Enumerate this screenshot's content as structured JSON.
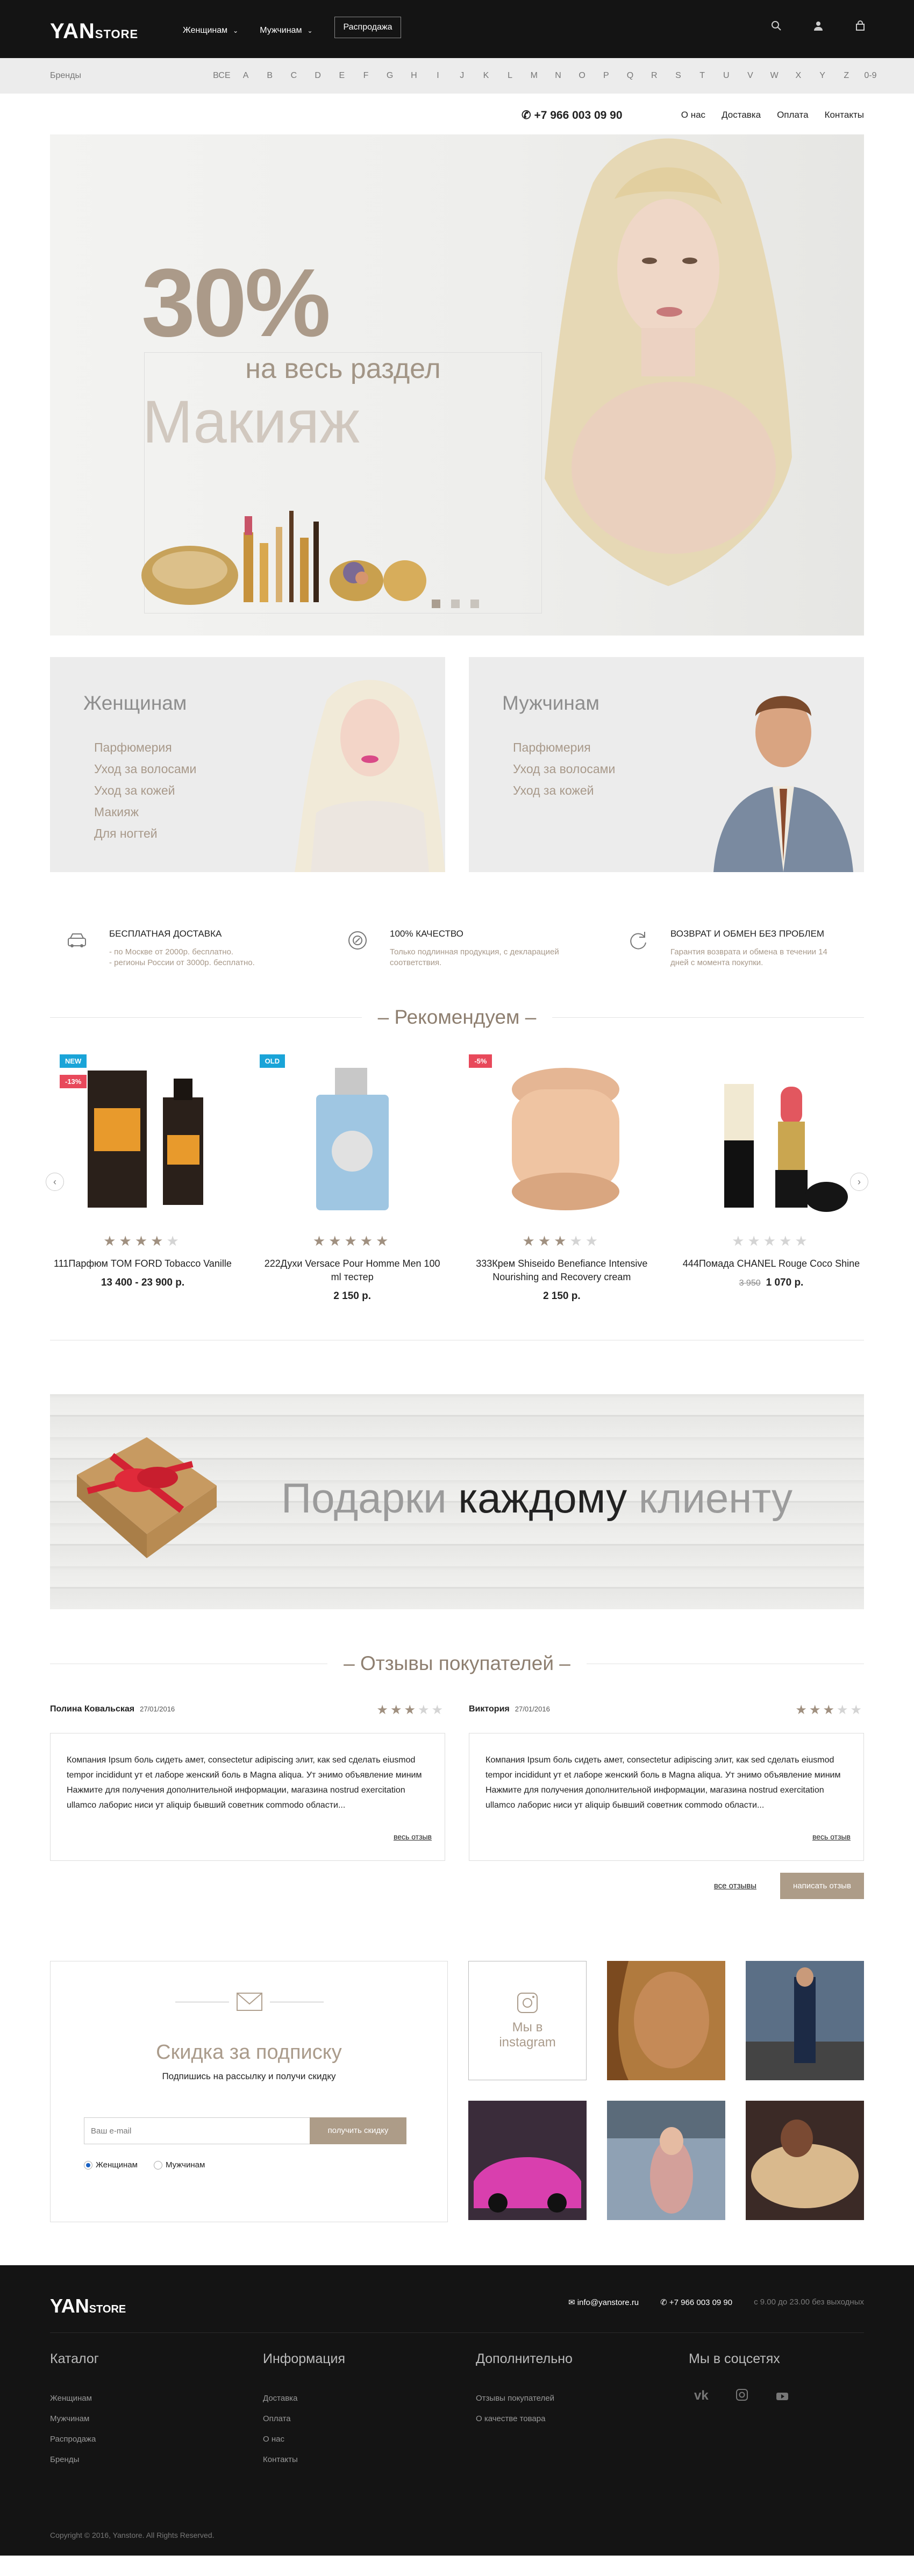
{
  "header": {
    "logo_main": "YAN",
    "logo_sub": "STORE",
    "nav": [
      {
        "label": "Женщинам"
      },
      {
        "label": "Мужчинам"
      }
    ],
    "sale": "Распродажа"
  },
  "brands": {
    "label": "Бренды",
    "letters": [
      "ВСЕ",
      "A",
      "B",
      "C",
      "D",
      "E",
      "F",
      "G",
      "H",
      "I",
      "J",
      "K",
      "L",
      "M",
      "N",
      "O",
      "P",
      "Q",
      "R",
      "S",
      "T",
      "U",
      "V",
      "W",
      "X",
      "Y",
      "Z",
      "0-9"
    ]
  },
  "utility": {
    "phone": "+7 966 003 09 90",
    "links": [
      "О нас",
      "Доставка",
      "Оплата",
      "Контакты"
    ]
  },
  "hero": {
    "percent": "30%",
    "subtitle": "на весь раздел",
    "category": "Макияж"
  },
  "categories": [
    {
      "title": "Женщинам",
      "items": [
        "Парфюмерия",
        "Уход за волосами",
        "Уход за кожей",
        "Макияж",
        "Для ногтей"
      ]
    },
    {
      "title": "Мужчинам",
      "items": [
        "Парфюмерия",
        "Уход за волосами",
        "Уход за кожей"
      ]
    }
  ],
  "features": [
    {
      "title": "БЕСПЛАТНАЯ ДОСТАВКА",
      "lines": [
        "- по Москве от 2000р. бесплатно.",
        "- регионы России от 3000р. бесплатно."
      ]
    },
    {
      "title": "100% КАЧЕСТВО",
      "lines": [
        "Только подлинная продукция, с декларацией",
        "соответствия."
      ]
    },
    {
      "title": "ВОЗВРАТ И ОБМЕН БЕЗ ПРОБЛЕМ",
      "lines": [
        "Гарантия возврата и обмена в течении 14",
        "дней с момента покупки."
      ]
    }
  ],
  "recommend": {
    "title": "Рекомендуем"
  },
  "products": [
    {
      "badges": [
        "NEW",
        "-13%"
      ],
      "rating": 4,
      "name": "111Парфюм TOM FORD Tobacco Vanille",
      "old_price": "",
      "price": "13 400 - 23 900 р."
    },
    {
      "badges": [
        "OLD"
      ],
      "rating": 5,
      "name": "222Духи Versace Pour Homme Men 100 ml тестер",
      "old_price": "",
      "price": "2 150 р."
    },
    {
      "badges": [
        "-5%"
      ],
      "rating": 3,
      "name": "333Крем Shiseido Benefiance Intensive Nourishing and Recovery cream",
      "old_price": "",
      "price": "2 150 р."
    },
    {
      "badges": [],
      "rating": 0,
      "name": "444Помада CHANEL Rouge Coco Shine",
      "old_price": "3 950",
      "price": "1 070 р."
    }
  ],
  "gift": {
    "part1": "Подарки",
    "part2": "каждому",
    "part3": "клиенту"
  },
  "reviews_title": "Отзывы покупателей",
  "reviews": [
    {
      "author": "Полина Ковальская",
      "date": "27/01/2016",
      "rating": 3,
      "text": "Компания Ipsum боль сидеть амет, consectetur adipiscing элит, как sed сделать eiusmod tempor incididunt ут et лаборе женский боль в Magna aliqua. Ут энимо объявление миним Нажмите для получения дополнительной информации, магазина nostrud exercitation ullamco лаборис ниси ут aliquip бывший советник commodo области...",
      "all": "весь отзыв"
    },
    {
      "author": "Виктория",
      "date": "27/01/2016",
      "rating": 3,
      "text": "Компания Ipsum боль сидеть амет, consectetur adipiscing элит, как sed сделать eiusmod tempor incididunt ут et лаборе женский боль в Magna aliqua. Ут энимо объявление миним Нажмите для получения дополнительной информации, магазина nostrud exercitation ullamco лаборис ниси ут aliquip бывший советник commodo области...",
      "all": "весь отзыв"
    }
  ],
  "reviews_actions": {
    "all": "все отзывы",
    "write": "написать отзыв"
  },
  "subscribe": {
    "title": "Скидка за подписку",
    "subtitle": "Подпишись на рассылку и получи скидку",
    "placeholder": "Ваш e-mail",
    "button": "получить скидку",
    "options": [
      "Женщинам",
      "Мужчинам"
    ]
  },
  "instagram": {
    "label_line1": "Мы в",
    "label_line2": "instagram"
  },
  "footer": {
    "email": "info@yanstore.ru",
    "phone": "+7 966 003 09 90",
    "hours": "с 9.00 до 23.00 без выходных",
    "columns": [
      {
        "title": "Каталог",
        "links": [
          "Женщинам",
          "Мужчинам",
          "Распродажа",
          "Бренды"
        ]
      },
      {
        "title": "Информация",
        "links": [
          "Доставка",
          "Оплата",
          "О нас",
          "Контакты"
        ]
      },
      {
        "title": "Дополнительно",
        "links": [
          "Отзывы покупателей",
          "О качестве товара"
        ]
      },
      {
        "title": "Мы в соцсетях",
        "links": []
      }
    ],
    "copyright": "Copyright © 2016, Yanstore. All Rights Reserved."
  },
  "colors": {
    "accent": "#ad9c88",
    "dark": "#141414",
    "new_badge": "#1aa4d8",
    "sale_badge": "#e8495b"
  }
}
